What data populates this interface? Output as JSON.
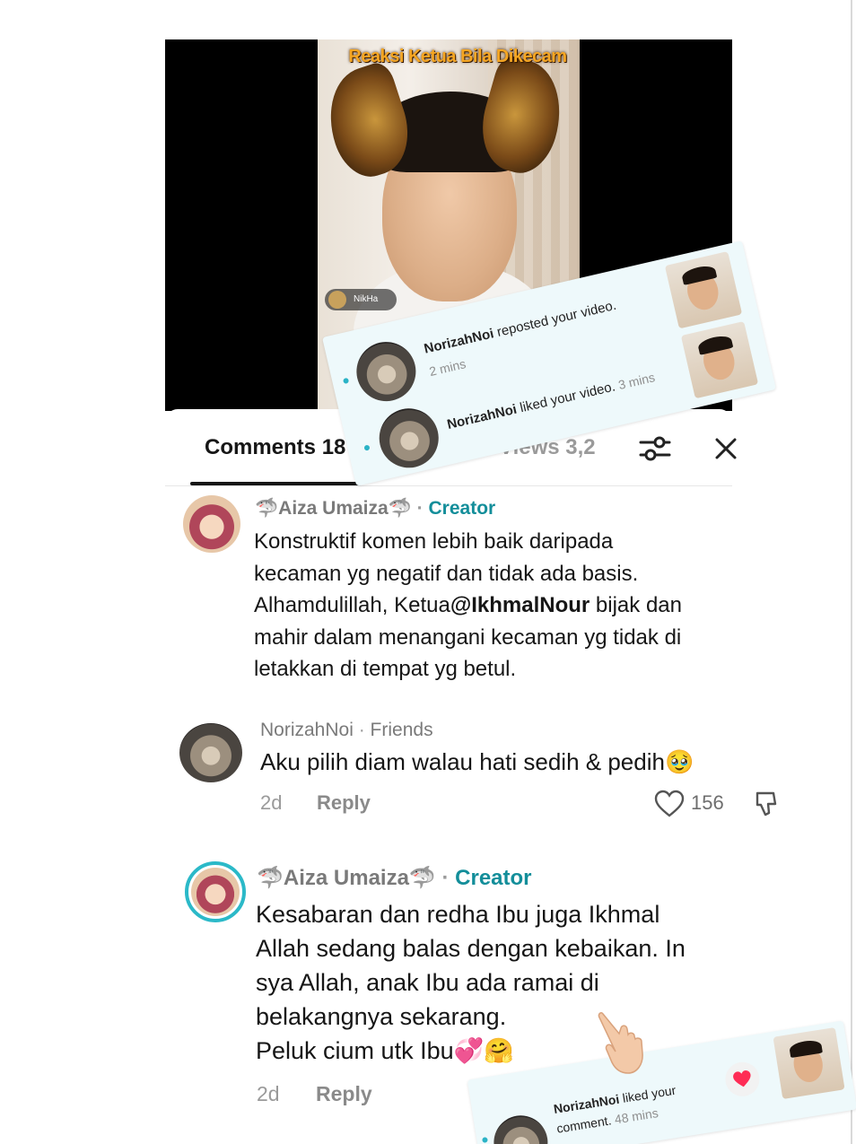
{
  "video": {
    "title": "Reaksi Ketua Bila Dikecam",
    "live_chip_name": "NikHa"
  },
  "sheet": {
    "tab_comments": "Comments 18",
    "tab_views": "Views 3,2"
  },
  "comments": [
    {
      "name": "🦈Aiza Umaiza🦈",
      "badge": "Creator",
      "lines": [
        "Konstruktif komen lebih baik daripada",
        "kecaman yg negatif dan tidak ada basis.",
        "Alhamdulillah, Ketua",
        "@IkhmalNour",
        " bijak dan",
        "mahir dalam menangani kecaman yg tidak di",
        "letakkan di tempat yg betul."
      ]
    },
    {
      "name": "NorizahNoi",
      "badge": "Friends",
      "text": "Aku pilih diam walau hati sedih & pedih🥹",
      "time": "2d",
      "reply": "Reply",
      "likes": "156"
    },
    {
      "name": "🦈Aiza Umaiza🦈",
      "badge": "Creator",
      "lines": [
        "Kesabaran dan redha Ibu juga Ikhmal",
        "Allah sedang balas dengan kebaikan. In",
        "sya Allah, anak Ibu ada ramai di",
        "belakangnya sekarang.",
        "Peluk cium utk Ibu💞🤗"
      ],
      "time": "2d",
      "reply": "Reply"
    }
  ],
  "notifications": [
    {
      "user": "NorizahNoi",
      "action": " reposted your video.",
      "time": "2 mins"
    },
    {
      "user": "NorizahNoi",
      "action": " liked your video.",
      "time": "3 mins"
    },
    {
      "user": "NorizahNoi",
      "action": " liked your",
      "action2": "comment.",
      "time": "48 mins"
    }
  ],
  "colors": {
    "creator": "#138e9a",
    "notification_bg": "#eef9fb",
    "heart": "#fe2c55"
  }
}
